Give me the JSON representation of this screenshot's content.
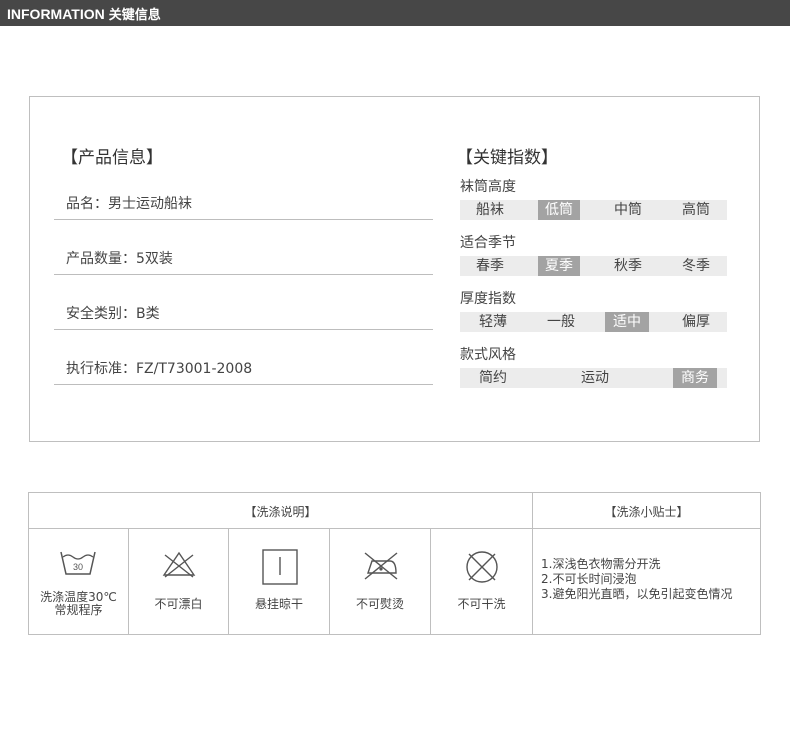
{
  "header": {
    "title_en": "INFORMATION",
    "title_cn": "关键信息"
  },
  "product": {
    "title": "【产品信息】",
    "rows": [
      {
        "label": "品名：男士运动船袜"
      },
      {
        "label": "产品数量：5双装"
      },
      {
        "label": "安全类别：B类"
      },
      {
        "label": "执行标准：FZ/T73001-2008"
      }
    ]
  },
  "key_index": {
    "title": "【关键指数】",
    "groups": [
      {
        "label": "袜筒高度",
        "options": [
          "船袜",
          "低筒",
          "中筒",
          "高筒"
        ],
        "selected": 1
      },
      {
        "label": "适合季节",
        "options": [
          "春季",
          "夏季",
          "秋季",
          "冬季"
        ],
        "selected": 1
      },
      {
        "label": "厚度指数",
        "options": [
          "轻薄",
          "一般",
          "适中",
          "偏厚"
        ],
        "selected": 2
      },
      {
        "label": "款式风格",
        "options": [
          "简约",
          "运动",
          "商务"
        ],
        "selected": 2
      }
    ]
  },
  "wash": {
    "title": "【洗涤说明】",
    "tips_title": "【洗涤小贴士】",
    "temp": "30",
    "icons": [
      {
        "name": "wash-30-icon",
        "label": "洗涤温度30℃",
        "label2": "常规程序"
      },
      {
        "name": "no-bleach-icon",
        "label": "不可漂白"
      },
      {
        "name": "hang-dry-icon",
        "label": "悬挂晾干"
      },
      {
        "name": "no-iron-icon",
        "label": "不可熨烫"
      },
      {
        "name": "no-dry-clean-icon",
        "label": "不可干洗"
      }
    ],
    "tips": [
      "1.深浅色衣物需分开洗",
      "2.不可长时间浸泡",
      "3.避免阳光直晒，以免引起变色情况"
    ]
  },
  "colors": {
    "header_bg": "#474747",
    "selected_bg": "#a3a3a3",
    "bar_bg": "#ececec",
    "border": "#bfbfbf"
  }
}
